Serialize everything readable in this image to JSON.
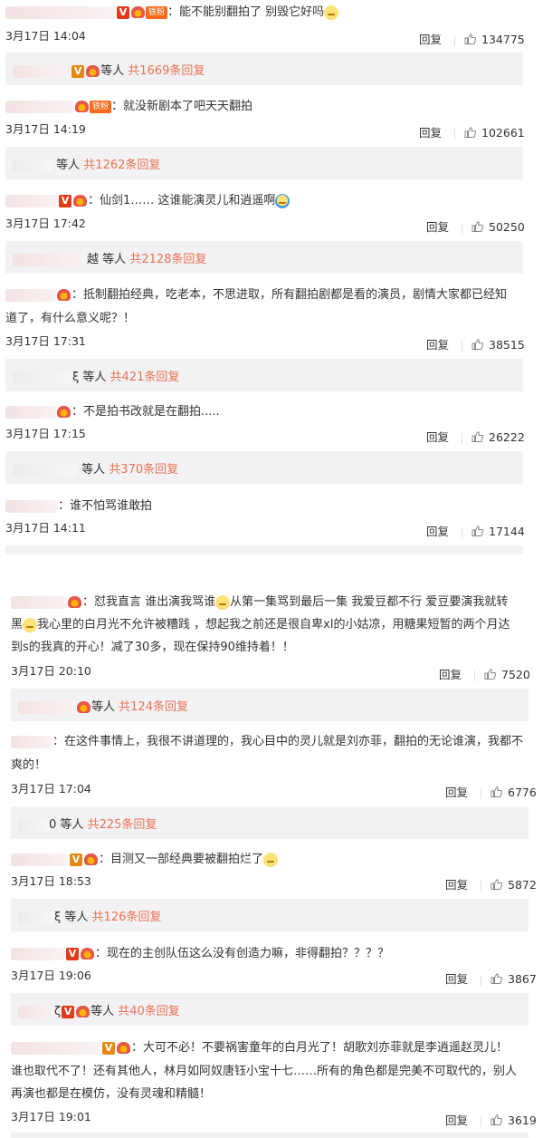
{
  "comments": [
    {
      "text": "：能不能别翻拍了 别毁它好吗",
      "date": "3月17日 14:04",
      "reply_label": "回复",
      "likes": "134775",
      "badges": [
        "v",
        "lv",
        "fan"
      ],
      "fan_label": "铁粉",
      "replies": {
        "suffix": "等人",
        "count": "共1669条回复"
      }
    },
    {
      "text": "：就没新剧本了吧天天翻拍",
      "date": "3月17日 14:19",
      "reply_label": "回复",
      "likes": "102661",
      "fan_label": "铁粉",
      "replies": {
        "suffix": "等人",
        "count": "共1262条回复"
      }
    },
    {
      "text": "：仙剑1…… 这谁能演灵儿和逍遥啊",
      "date": "3月17日 17:42",
      "reply_label": "回复",
      "likes": "50250",
      "replies": {
        "prefix": "越",
        "suffix": "等人",
        "count": "共2128条回复"
      }
    },
    {
      "text_line1": "：抵制翻拍经典，吃老本，不思进取，所有翻拍剧都是看的演员，剧情大家都已经知",
      "text_line2": "道了，有什么意义呢？！",
      "date": "3月17日 17:31",
      "reply_label": "回复",
      "likes": "38515",
      "replies": {
        "prefix": "ξ",
        "suffix": "等人",
        "count": "共421条回复"
      }
    },
    {
      "text": "：不是拍书改就是在翻拍.....",
      "date": "3月17日 17:15",
      "reply_label": "回复",
      "likes": "26222",
      "replies": {
        "suffix": "等人",
        "count": "共370条回复"
      }
    },
    {
      "text": "：谁不怕骂谁敢拍",
      "date": "3月17日 14:11",
      "reply_label": "回复",
      "likes": "17144"
    },
    {
      "text_line1a": "：怼我直言 谁出演我骂谁",
      "text_line1b": "从第一集骂到最后一集 我爱豆都不行 爱豆要演我就转",
      "text_line2a": "黑",
      "text_line2b": "我心里的白月光不允许被糟践 ，想起我之前还是很自卑xl的小姑凉，用糖果短暂的两个月达",
      "text_line3": "到s的我真的开心！减了30多，现在保持90维持着！！",
      "date": "3月17日 20:10",
      "reply_label": "回复",
      "likes": "7520",
      "replies": {
        "suffix": "等人",
        "count": "共124条回复"
      }
    },
    {
      "text_line1": "：在这件事情上，我很不讲道理的，我心目中的灵儿就是刘亦菲，翻拍的无论谁演，我都不",
      "text_line2": "爽的！",
      "date": "3月17日 17:04",
      "reply_label": "回复",
      "likes": "6776",
      "replies": {
        "prefix": "0",
        "suffix": "等人",
        "count": "共225条回复"
      }
    },
    {
      "text": "：目测又一部经典要被翻拍烂了",
      "date": "3月17日 18:53",
      "reply_label": "回复",
      "likes": "5872",
      "replies": {
        "prefix": "ξ",
        "suffix": "等人",
        "count": "共126条回复"
      }
    },
    {
      "text": "：现在的主创队伍这么没有创造力嘛，非得翻拍？？？？",
      "date": "3月17日 19:06",
      "reply_label": "回复",
      "likes": "3867",
      "replies": {
        "prefix": "ζ",
        "suffix": "等人",
        "count": "共40条回复"
      }
    },
    {
      "text_line1": "：大可不必！不要祸害童年的白月光了！胡歌刘亦菲就是李逍遥赵灵儿！",
      "text_line2": "谁也取代不了！还有其他人，林月如阿奴唐钰小宝十七……所有的角色都是完美不可取代的，别人",
      "text_line3": "再演也都是在模仿，没有灵魂和精髓！",
      "date": "3月17日 19:01",
      "reply_label": "回复",
      "likes": "3619"
    }
  ],
  "icons": {
    "verified": "V",
    "level": "crown-icon",
    "like": "thumb-up-icon",
    "emoji": "smile-emoji-icon"
  },
  "colors": {
    "count_accent": "#eb7350",
    "reply_box": "#f2f2f5",
    "v_badge": "#e8870e"
  }
}
